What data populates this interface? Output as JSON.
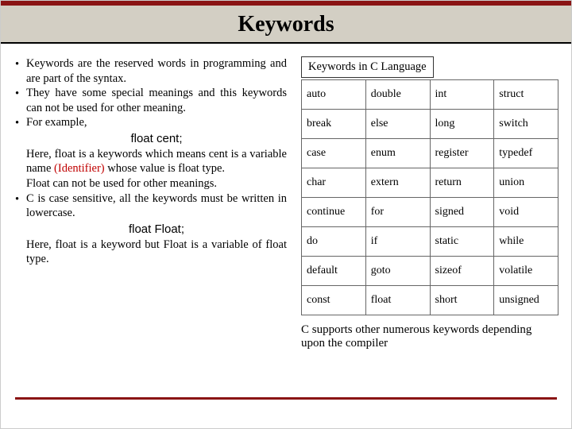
{
  "title": "Keywords",
  "bullets": {
    "b1": "Keywords are the reserved words in programming and are part of the syntax.",
    "b2": "They have some special meanings and this keywords can not be used for other meaning.",
    "b3": "For example,",
    "code1": "float cent;",
    "b3_cont_a": "Here, float is a keywords which means cent is a variable name ",
    "identifier": "(Identifier)",
    "b3_cont_b": " whose value is float type.",
    "b3_cont_c": "Float can not be used for other meanings.",
    "b4": "C is case sensitive, all the keywords must be written in lowercase.",
    "code2": "float Float;",
    "b4_cont": "Here, float is a keyword but Float is a variable of float type."
  },
  "table_title": "Keywords in C Language",
  "chart_data": {
    "type": "table",
    "title": "Keywords in C Language",
    "rows": [
      [
        "auto",
        "double",
        "int",
        "struct"
      ],
      [
        "break",
        "else",
        "long",
        "switch"
      ],
      [
        "case",
        "enum",
        "register",
        "typedef"
      ],
      [
        "char",
        "extern",
        "return",
        "union"
      ],
      [
        "continue",
        "for",
        "signed",
        "void"
      ],
      [
        "do",
        "if",
        "static",
        "while"
      ],
      [
        "default",
        "goto",
        "sizeof",
        "volatile"
      ],
      [
        "const",
        "float",
        "short",
        "unsigned"
      ]
    ]
  },
  "footnote": "C supports other numerous keywords depending upon the compiler"
}
